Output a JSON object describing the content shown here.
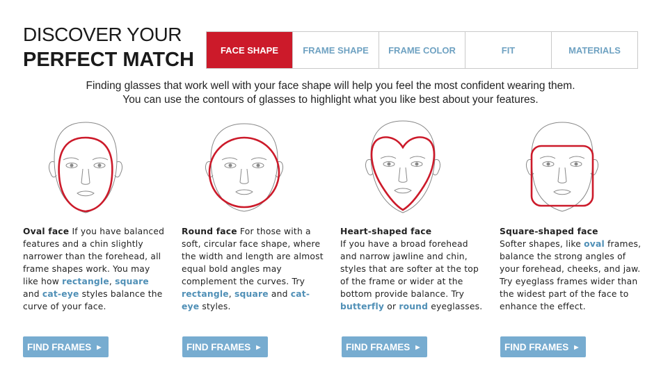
{
  "header": {
    "title_line1": "DISCOVER YOUR",
    "title_line2": "PERFECT MATCH"
  },
  "tabs": [
    {
      "label": "FACE SHAPE",
      "active": true
    },
    {
      "label": "FRAME SHAPE",
      "active": false
    },
    {
      "label": "FRAME COLOR",
      "active": false
    },
    {
      "label": "FIT",
      "active": false
    },
    {
      "label": "MATERIALS",
      "active": false
    }
  ],
  "intro": {
    "line1": "Finding glasses that work well with your face shape will help you feel the most confident wearing them.",
    "line2": "You can use the contours of glasses to highlight what you like best about your features."
  },
  "faces": [
    {
      "heading": "Oval face",
      "parts": [
        {
          "t": " If you have balanced features and a chin slightly narrower than the forehead, all frame shapes work. You may like how ",
          "hl": false
        },
        {
          "t": "rectangle",
          "hl": true
        },
        {
          "t": ", ",
          "hl": false
        },
        {
          "t": "square",
          "hl": true
        },
        {
          "t": " and ",
          "hl": false
        },
        {
          "t": "cat-eye",
          "hl": true
        },
        {
          "t": " styles balance the curve of your face.",
          "hl": false
        }
      ],
      "button": "FIND FRAMES"
    },
    {
      "heading": "Round face",
      "parts": [
        {
          "t": " For those with a soft, circular face shape, where the width and length are almost equal bold angles may complement the curves. Try ",
          "hl": false
        },
        {
          "t": "rectangle",
          "hl": true
        },
        {
          "t": ", ",
          "hl": false
        },
        {
          "t": "square",
          "hl": true
        },
        {
          "t": " and ",
          "hl": false
        },
        {
          "t": "cat-eye",
          "hl": true
        },
        {
          "t": " styles.",
          "hl": false
        }
      ],
      "button": "FIND FRAMES"
    },
    {
      "heading": "Heart-shaped face",
      "parts": [
        {
          "t": "If you have a broad forehead and narrow jawline and chin, styles that are softer at the top of the frame or wider at the bottom provide balance. Try ",
          "hl": false
        },
        {
          "t": "butterfly",
          "hl": true
        },
        {
          "t": " or ",
          "hl": false
        },
        {
          "t": "round",
          "hl": true
        },
        {
          "t": " eyeglasses.",
          "hl": false
        }
      ],
      "button": "FIND FRAMES"
    },
    {
      "heading": "Square-shaped face",
      "parts": [
        {
          "t": "Softer shapes, like ",
          "hl": false
        },
        {
          "t": "oval",
          "hl": true
        },
        {
          "t": " frames, balance the strong angles of your forehead, cheeks, and jaw. Try eyeglass frames wider than the widest part of the face to enhance the effect.",
          "hl": false
        }
      ],
      "button": "FIND FRAMES"
    }
  ],
  "colors": {
    "accent_red": "#cc1a2a",
    "link_blue": "#4f8fb6",
    "button_blue": "#77acd0"
  },
  "icons": {
    "button_arrow": "▶"
  }
}
